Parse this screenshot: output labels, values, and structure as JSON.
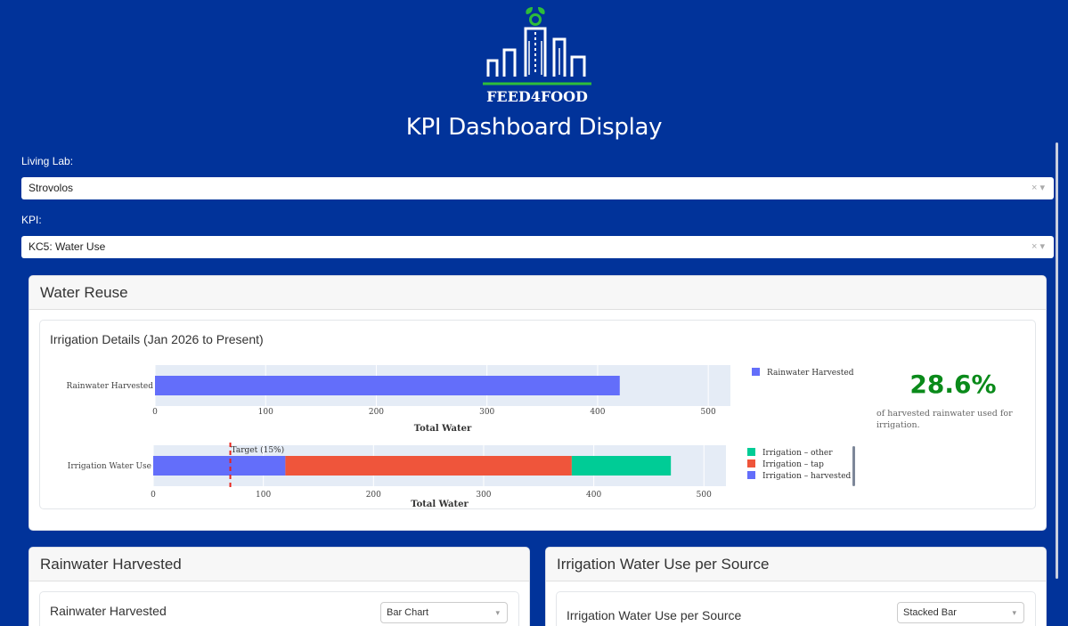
{
  "header": {
    "logo_text": "FEED4FOOD",
    "title": "KPI Dashboard Display"
  },
  "filters": {
    "living_lab_label": "Living Lab:",
    "living_lab_value": "Strovolos",
    "kpi_label": "KPI:",
    "kpi_value": "KC5: Water Use",
    "clear_glyph": "×",
    "dropdown_glyph": "▾"
  },
  "water_reuse": {
    "title": "Water Reuse",
    "panel_title": "Irrigation Details (Jan 2026 to Present)",
    "kpi_value": "28.6%",
    "kpi_description": "of harvested rainwater used for irrigation."
  },
  "chart_data": [
    {
      "type": "bar",
      "orientation": "horizontal",
      "categories": [
        "Rainwater Harvested"
      ],
      "series": [
        {
          "name": "Rainwater Harvested",
          "values": [
            420
          ],
          "color": "#636efa"
        }
      ],
      "xlabel": "Total Water",
      "xlim": [
        0,
        520
      ],
      "xticks": [
        0,
        100,
        200,
        300,
        400,
        500
      ],
      "legend": "right"
    },
    {
      "type": "bar",
      "orientation": "horizontal",
      "stacked": true,
      "categories": [
        "Irrigation Water Use"
      ],
      "series": [
        {
          "name": "Irrigation – harvested",
          "values": [
            120
          ],
          "color": "#636efa"
        },
        {
          "name": "Irrigation – tap",
          "values": [
            260
          ],
          "color": "#ef553b"
        },
        {
          "name": "Irrigation – other",
          "values": [
            90
          ],
          "color": "#00cc96"
        }
      ],
      "legend_order": [
        "Irrigation – other",
        "Irrigation – tap",
        "Irrigation – harvested"
      ],
      "annotation": {
        "text": "Target (15%)",
        "x": 70,
        "line_color": "#e8231a"
      },
      "xlabel": "Total Water",
      "xlim": [
        0,
        520
      ],
      "xticks": [
        0,
        100,
        200,
        300,
        400,
        500
      ],
      "legend": "right"
    }
  ],
  "rainwater_section": {
    "title": "Rainwater Harvested",
    "panel_title": "Rainwater Harvested",
    "chart_type_value": "Bar Chart"
  },
  "irrigation_section": {
    "title": "Irrigation Water Use per Source",
    "panel_title": "Irrigation Water Use per Source",
    "chart_type_value": "Stacked Bar"
  }
}
